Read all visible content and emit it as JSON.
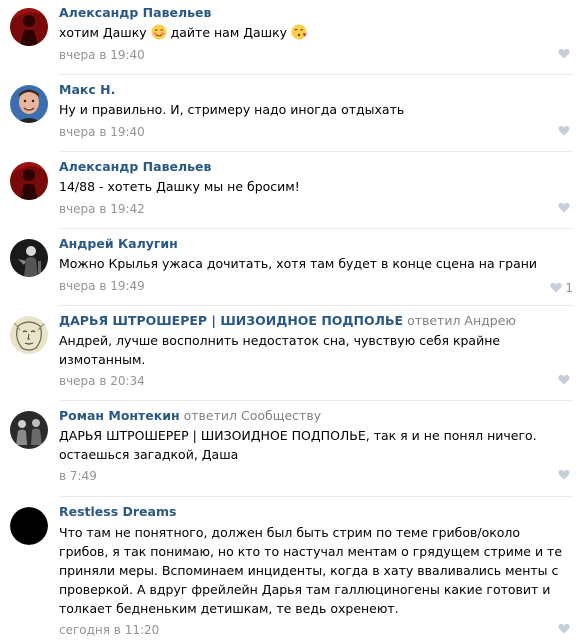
{
  "comments": [
    {
      "author": "Александр Павельев",
      "reply_prefix": "",
      "reply_target": "",
      "text_parts": [
        "хотим Дашку ",
        " дайте нам Дашку "
      ],
      "emoji": [
        "smiling-blush-emoji",
        "kissing-heart-emoji"
      ],
      "date": "вчера в 19:40",
      "likes": "",
      "avatar": "red-figure-avatar"
    },
    {
      "author": "Макс Н.",
      "reply_prefix": "",
      "reply_target": "",
      "text": "Ну и правильно. И, стримеру надо иногда отдыхать",
      "date": "вчера в 19:40",
      "likes": "",
      "avatar": "man-portrait-avatar"
    },
    {
      "author": "Александр Павельев",
      "reply_prefix": "",
      "reply_target": "",
      "text": "14/88 - хотеть Дашку мы не бросим!",
      "date": "вчера в 19:42",
      "likes": "",
      "avatar": "red-figure-avatar"
    },
    {
      "author": "Андрей Калугин",
      "reply_prefix": "",
      "reply_target": "",
      "text": "Можно Крылья ужаса дочитать, хотя там будет в конце сцена на грани",
      "date": "вчера в 19:49",
      "likes": "1",
      "avatar": "dark-figure-avatar"
    },
    {
      "author": "ДАРЬЯ ШТРОШЕРЕР | ШИЗОИДНОЕ ПОДПОЛЬЕ",
      "reply_prefix": " ответил ",
      "reply_target": "Андрею",
      "text": "Андрей, лучше восполнить недостаток сна, чувствую себя крайне измотанным.",
      "date": "вчера в 20:34",
      "likes": "",
      "avatar": "sketch-face-avatar"
    },
    {
      "author": "Роман Монтекин",
      "reply_prefix": " ответил ",
      "reply_target": "Сообществу",
      "text": "ДАРЬЯ ШТРОШЕРЕР | ШИЗОИДНОЕ ПОДПОЛЬЕ, так я и не понял ничего. остаешься загадкой, Даша",
      "date": "в 7:49",
      "likes": "",
      "avatar": "bw-photo-avatar"
    },
    {
      "author": "Restless Dreams",
      "reply_prefix": "",
      "reply_target": "",
      "text": "Что там не понятного, должен был быть стрим по теме грибов/около грибов, я так понимаю, но кто то настучал ментам о грядущем стриме и те приняли меры. Вспоминаем инциденты, когда в хату вваливались менты с проверкой. А вдруг фрейлейн Дарья там галлюциногены какие готовит и толкает бедненьким детишкам, те ведь охренеют.",
      "date": "сегодня в 11:20",
      "likes": "",
      "avatar": "black-circle-avatar"
    }
  ],
  "colors": {
    "author": "#2a5885",
    "meta": "#939393",
    "divider": "#e7e8ec"
  }
}
